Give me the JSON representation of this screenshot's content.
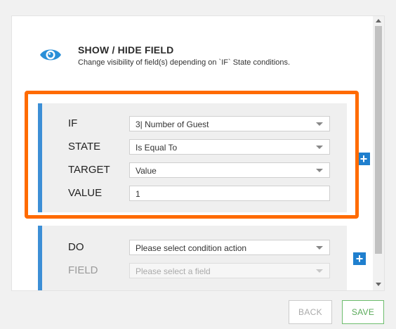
{
  "header": {
    "title": "SHOW / HIDE FIELD",
    "subtitle": "Change visibility of field(s) depending on `IF` State conditions."
  },
  "condition": {
    "if_label": "IF",
    "if_value": "3| Number of Guest",
    "state_label": "STATE",
    "state_value": "Is Equal To",
    "target_label": "TARGET",
    "target_value": "Value",
    "value_label": "VALUE",
    "value_value": "1"
  },
  "action": {
    "do_label": "DO",
    "do_value": "Please select condition action",
    "field_label": "FIELD",
    "field_value": "Please select a field"
  },
  "buttons": {
    "plus": "+",
    "back": "BACK",
    "save": "SAVE"
  },
  "colors": {
    "accent_blue": "#3c8fd6",
    "plus_blue": "#1f7fce",
    "highlight_orange": "#ff6b00",
    "save_green": "#5aaa5a"
  },
  "icons": {
    "header": "eye-icon",
    "select": "caret-down-icon",
    "add": "plus-icon"
  }
}
